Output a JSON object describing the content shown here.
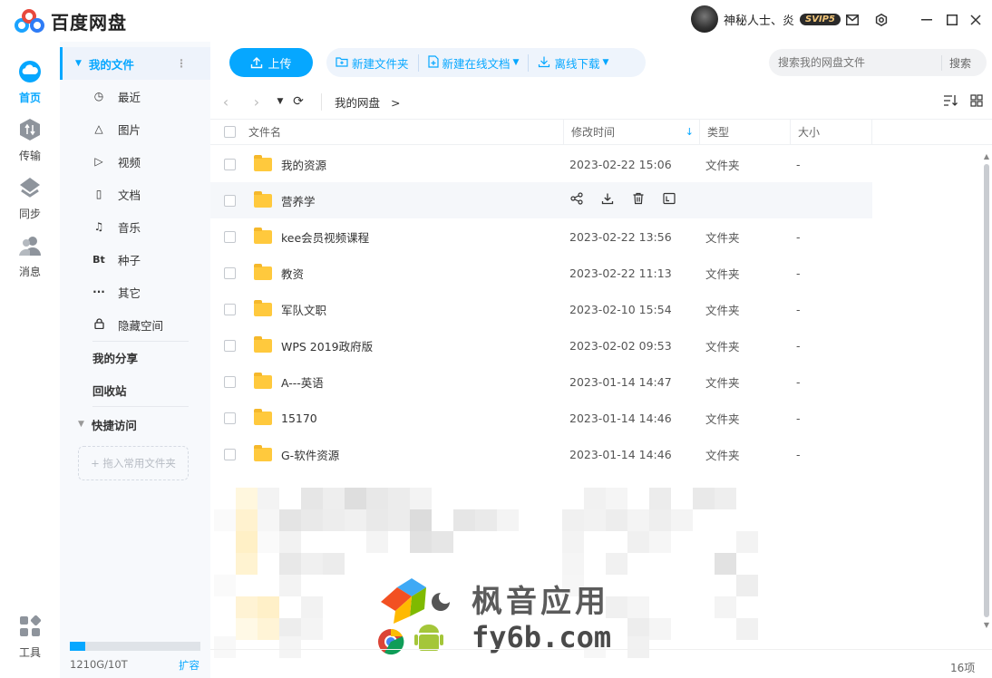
{
  "app": {
    "title": "百度网盘"
  },
  "user": {
    "name": "神秘人士、炎",
    "badge": "SVIP5"
  },
  "left_nav": [
    {
      "label": "首页",
      "icon": "cloud-icon",
      "active": true
    },
    {
      "label": "传输",
      "icon": "transfer-icon"
    },
    {
      "label": "同步",
      "icon": "sync-icon"
    },
    {
      "label": "消息",
      "icon": "message-icon"
    },
    {
      "label": "工具",
      "icon": "tools-icon"
    }
  ],
  "sidebar": {
    "my_files": "我的文件",
    "items": [
      {
        "label": "最近",
        "icon": "clock-icon",
        "glyph": "◷"
      },
      {
        "label": "图片",
        "icon": "image-icon",
        "glyph": "△"
      },
      {
        "label": "视频",
        "icon": "video-icon",
        "glyph": "▷"
      },
      {
        "label": "文档",
        "icon": "document-icon",
        "glyph": "▯"
      },
      {
        "label": "音乐",
        "icon": "headphones-icon",
        "glyph": "♫"
      },
      {
        "label": "种子",
        "icon": "bt-icon",
        "glyph": "Bt"
      },
      {
        "label": "其它",
        "icon": "more-icon",
        "glyph": "···"
      },
      {
        "label": "隐藏空间",
        "icon": "lock-icon",
        "glyph": "🔒"
      }
    ],
    "my_share": "我的分享",
    "recycle": "回收站",
    "quick_access": "快捷访问",
    "drop_hint": "+ 拖入常用文件夹",
    "quota": "1210G/10T",
    "quota_fraction": 0.12,
    "expand": "扩容"
  },
  "toolbar": {
    "upload": "上传",
    "new_folder": "新建文件夹",
    "new_online_doc": "新建在线文档",
    "offline_download": "离线下载",
    "search_placeholder": "搜索我的网盘文件",
    "search_button": "搜索"
  },
  "breadcrumb": {
    "root": "我的网盘",
    "sep": ">"
  },
  "table": {
    "headers": {
      "name": "文件名",
      "modified": "修改时间",
      "type": "类型",
      "size": "大小"
    },
    "rows": [
      {
        "name": "我的资源",
        "modified": "2023-02-22 15:06",
        "type": "文件夹",
        "size": "-"
      },
      {
        "name": "营养学",
        "modified": "",
        "type": "",
        "size": "",
        "hover": true
      },
      {
        "name": "kee会员视频课程",
        "modified": "2023-02-22 13:56",
        "type": "文件夹",
        "size": "-"
      },
      {
        "name": "教资",
        "modified": "2023-02-22 11:13",
        "type": "文件夹",
        "size": "-"
      },
      {
        "name": "军队文职",
        "modified": "2023-02-10 15:54",
        "type": "文件夹",
        "size": "-"
      },
      {
        "name": "WPS 2019政府版",
        "modified": "2023-02-02 09:53",
        "type": "文件夹",
        "size": "-"
      },
      {
        "name": "A---英语",
        "modified": "2023-01-14 14:47",
        "type": "文件夹",
        "size": "-"
      },
      {
        "name": "15170",
        "modified": "2023-01-14 14:46",
        "type": "文件夹",
        "size": "-"
      },
      {
        "name": "G-软件资源",
        "modified": "2023-01-14 14:46",
        "type": "文件夹",
        "size": "-"
      }
    ]
  },
  "status": {
    "count": "16项"
  },
  "watermark": {
    "line1": "枫音应用",
    "line2": "fy6b.com"
  },
  "colors": {
    "accent": "#06a7ff",
    "folder": "#ffc93d"
  }
}
